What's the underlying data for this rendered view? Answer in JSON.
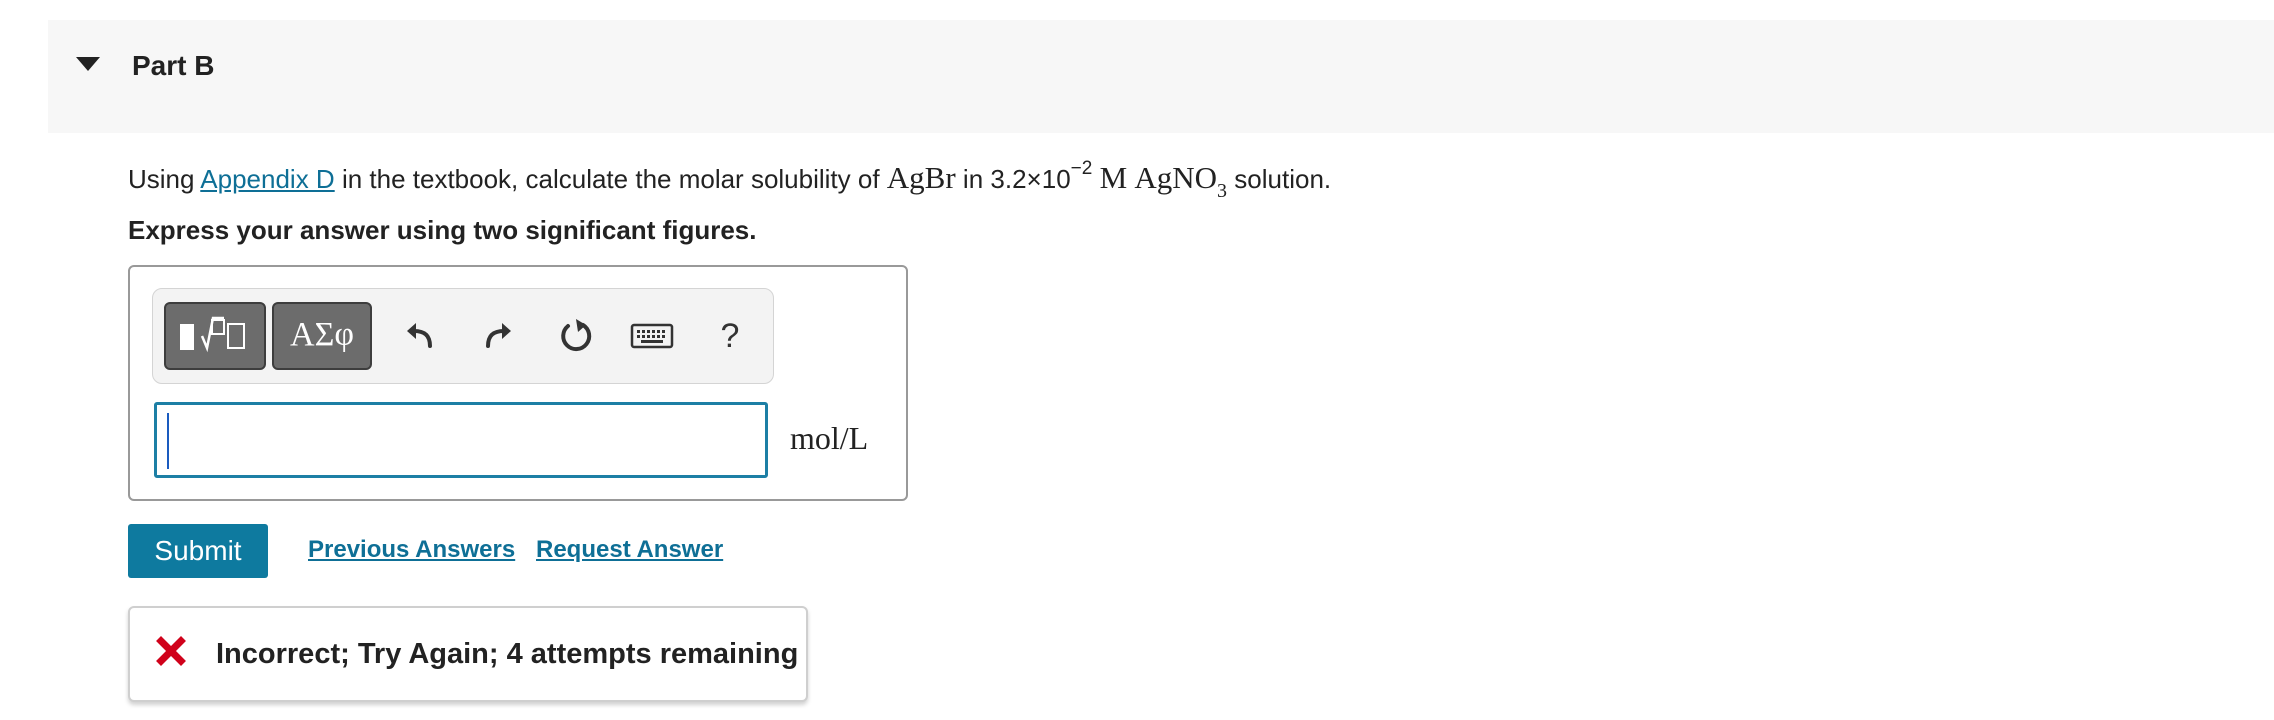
{
  "part": {
    "title": "Part B"
  },
  "question": {
    "prefix": "Using",
    "link_text": "Appendix D",
    "mid": "in the textbook, calculate the molar solubility of",
    "compound": "AgBr",
    "in_word": "in",
    "conc_mantissa": "3.2×10",
    "conc_exponent": "−2",
    "unit_M": "M",
    "reagent": "AgNO",
    "reagent_sub": "3",
    "suffix": "solution."
  },
  "instruction": "Express your answer using two significant figures.",
  "toolbar": {
    "templates_icon": "templates-icon",
    "greek_label": "ΑΣφ",
    "undo_icon": "undo-icon",
    "redo_icon": "redo-icon",
    "reset_icon": "reset-icon",
    "keyboard_icon": "keyboard-icon",
    "help_label": "?"
  },
  "answer": {
    "value": "",
    "unit": "mol/L"
  },
  "actions": {
    "submit_label": "Submit",
    "previous_answers_label": "Previous Answers",
    "request_answer_label": "Request Answer"
  },
  "feedback": {
    "icon": "incorrect-x-icon",
    "message": "Incorrect; Try Again; 4 attempts remaining",
    "color": "#d0021b"
  },
  "colors": {
    "accent": "#0e7a9f",
    "link": "#0e6f96",
    "input_border": "#1d7fa5"
  }
}
